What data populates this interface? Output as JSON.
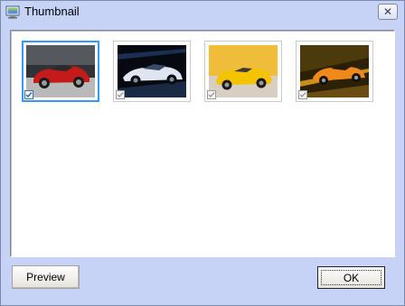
{
  "window": {
    "title": "Thumbnail",
    "close_symbol": "✕"
  },
  "thumbnails": [
    {
      "name": "red-car",
      "checked": true,
      "selected": true,
      "color": "#c01818",
      "bg": "#3c3c3c",
      "ground": "#b6b6b6"
    },
    {
      "name": "silver-car",
      "checked": true,
      "selected": false,
      "color": "#d8e0ec",
      "bg": "#0a1018",
      "ground": "#1e2c44"
    },
    {
      "name": "yellow-car",
      "checked": true,
      "selected": false,
      "color": "#f5c400",
      "bg": "#f1c24a",
      "ground": "#d3c9bd"
    },
    {
      "name": "orange-car",
      "checked": true,
      "selected": false,
      "color": "#f08a1a",
      "bg": "#3a2a08",
      "ground": "#6a4a10"
    }
  ],
  "buttons": {
    "preview_label": "Preview",
    "ok_label": "OK"
  },
  "icons": {
    "title_icon": "thumbnail-app-icon",
    "close_icon": "close-icon",
    "check_icon": "check-icon"
  }
}
